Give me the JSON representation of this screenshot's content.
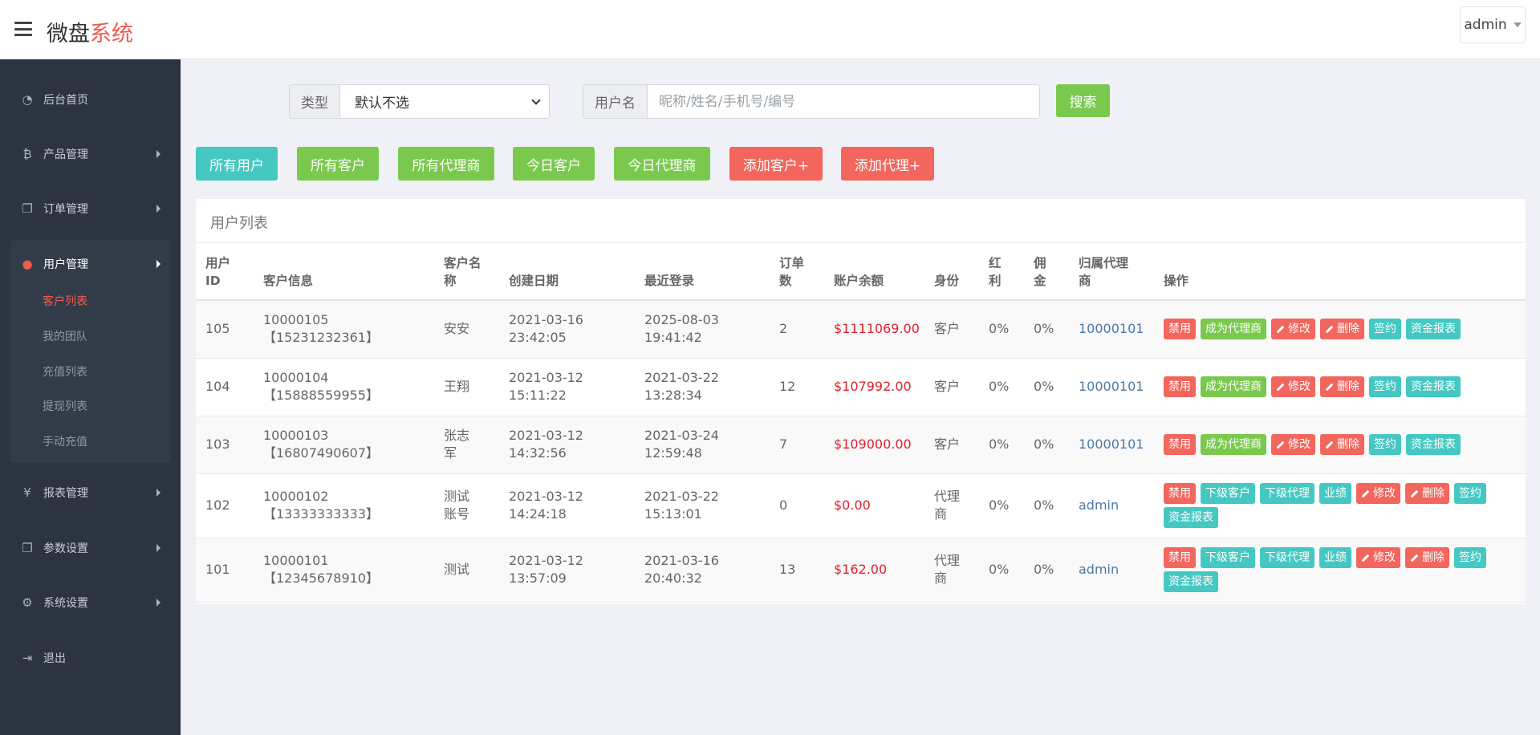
{
  "header": {
    "brand_main": "微盘",
    "brand_accent": "系统",
    "user": "admin"
  },
  "sidebar": {
    "items": [
      {
        "label": "后台首页",
        "icon": "dashboard-icon"
      },
      {
        "label": "产品管理",
        "icon": "bitcoin-icon"
      },
      {
        "label": "订单管理",
        "icon": "copy-icon"
      },
      {
        "label": "用户管理",
        "icon": "user-icon"
      },
      {
        "label": "报表管理",
        "icon": "yen-icon"
      },
      {
        "label": "参数设置",
        "icon": "copy-icon"
      },
      {
        "label": "系统设置",
        "icon": "gears-icon"
      },
      {
        "label": "退出",
        "icon": "sign-out-icon"
      }
    ],
    "sub_items": [
      "客户列表",
      "我的团队",
      "充值列表",
      "提现列表",
      "手动充值"
    ],
    "active_sub": "客户列表"
  },
  "search": {
    "type_label": "类型",
    "type_selected": "默认不选",
    "name_label": "用户名",
    "name_placeholder": "昵称/姓名/手机号/编号",
    "search_button": "搜索"
  },
  "filters": [
    {
      "label": "所有用户",
      "color": "#45c8c2"
    },
    {
      "label": "所有客户",
      "color": "#7ac94e"
    },
    {
      "label": "所有代理商",
      "color": "#7ac94e"
    },
    {
      "label": "今日客户",
      "color": "#7ac94e"
    },
    {
      "label": "今日代理商",
      "color": "#7ac94e"
    },
    {
      "label": "添加客户+",
      "color": "#f2665d"
    },
    {
      "label": "添加代理+",
      "color": "#f2665d"
    }
  ],
  "panel": {
    "title": "用户列表",
    "columns": [
      "用户ID",
      "客户信息",
      "客户名称",
      "创建日期",
      "最近登录",
      "订单数",
      "账户余额",
      "身份",
      "红利",
      "佣金",
      "归属代理商",
      "操作"
    ],
    "rows": [
      {
        "id": "105",
        "code": "10000105",
        "phone": "【15231232361】",
        "name": "安安",
        "created_date": "2021-03-16",
        "created_time": "23:42:05",
        "login_date": "2025-08-03",
        "login_time": "19:41:42",
        "orders": "2",
        "balance": "$1111069.00",
        "role": "客户",
        "bonus": "0%",
        "commission": "0%",
        "agent": "10000101"
      },
      {
        "id": "104",
        "code": "10000104",
        "phone": "【15888559955】",
        "name": "王翔",
        "created_date": "2021-03-12",
        "created_time": "15:11:22",
        "login_date": "2021-03-22",
        "login_time": "13:28:34",
        "orders": "12",
        "balance": "$107992.00",
        "role": "客户",
        "bonus": "0%",
        "commission": "0%",
        "agent": "10000101"
      },
      {
        "id": "103",
        "code": "10000103",
        "phone": "【16807490607】",
        "name": "张志军",
        "created_date": "2021-03-12",
        "created_time": "14:32:56",
        "login_date": "2021-03-24",
        "login_time": "12:59:48",
        "orders": "7",
        "balance": "$109000.00",
        "role": "客户",
        "bonus": "0%",
        "commission": "0%",
        "agent": "10000101"
      },
      {
        "id": "102",
        "code": "10000102",
        "phone": "【13333333333】",
        "name": "测试账号",
        "created_date": "2021-03-12",
        "created_time": "14:24:18",
        "login_date": "2021-03-22",
        "login_time": "15:13:01",
        "orders": "0",
        "balance": "$0.00",
        "role": "代理商",
        "bonus": "0%",
        "commission": "0%",
        "agent": "admin"
      },
      {
        "id": "101",
        "code": "10000101",
        "phone": "【12345678910】",
        "name": "测试",
        "created_date": "2021-03-12",
        "created_time": "13:57:09",
        "login_date": "2021-03-16",
        "login_time": "20:40:32",
        "orders": "13",
        "balance": "$162.00",
        "role": "代理商",
        "bonus": "0%",
        "commission": "0%",
        "agent": "admin"
      }
    ],
    "client_actions": [
      {
        "label": "禁用",
        "color": "red",
        "pen": false
      },
      {
        "label": "成为代理商",
        "color": "green",
        "pen": false
      },
      {
        "label": "修改",
        "color": "red",
        "pen": true
      },
      {
        "label": "删除",
        "color": "red",
        "pen": true
      },
      {
        "label": "签约",
        "color": "cyan",
        "pen": false
      },
      {
        "label": "资金报表",
        "color": "cyan",
        "pen": false
      }
    ],
    "agent_actions": [
      {
        "label": "禁用",
        "color": "red",
        "pen": false
      },
      {
        "label": "下级客户",
        "color": "cyan",
        "pen": false
      },
      {
        "label": "下级代理",
        "color": "cyan",
        "pen": false
      },
      {
        "label": "业绩",
        "color": "cyan",
        "pen": false
      },
      {
        "label": "修改",
        "color": "red",
        "pen": true
      },
      {
        "label": "删除",
        "color": "red",
        "pen": true
      },
      {
        "label": "签约",
        "color": "cyan",
        "pen": false
      },
      {
        "label": "资金报表",
        "color": "cyan",
        "pen": false
      }
    ]
  }
}
